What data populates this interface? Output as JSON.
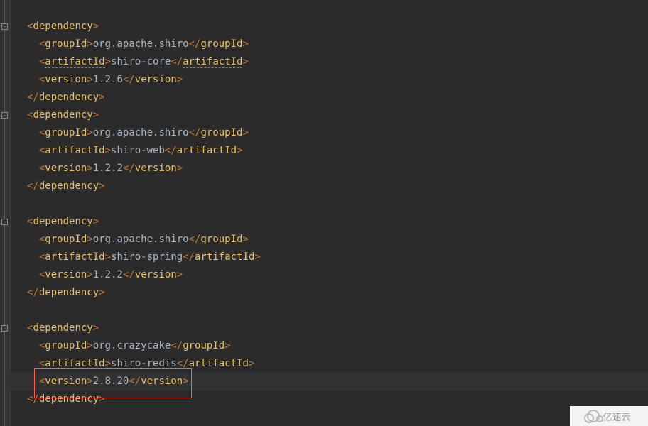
{
  "watermark": "亿速云",
  "dependencies": [
    {
      "groupId": "org.apache.shiro",
      "artifactId": "shiro-core",
      "artifactWarn": true,
      "version": "1.2.6"
    },
    {
      "groupId": "org.apache.shiro",
      "artifactId": "shiro-web",
      "artifactWarn": false,
      "version": "1.2.2"
    },
    {
      "groupId": "org.apache.shiro",
      "artifactId": "shiro-spring",
      "artifactWarn": false,
      "version": "1.2.2"
    },
    {
      "groupId": "org.crazycake",
      "artifactId": "shiro-redis",
      "artifactWarn": false,
      "version": "2.8.20"
    }
  ],
  "tags": {
    "dependency": "dependency",
    "groupId": "groupId",
    "artifactId": "artifactId",
    "version": "version"
  },
  "blankLines": {
    "afterBlock1": 0,
    "afterBlock2": 1,
    "afterBlock3": 1
  },
  "caretLineIndex": 20,
  "caretAfterVersion": true
}
